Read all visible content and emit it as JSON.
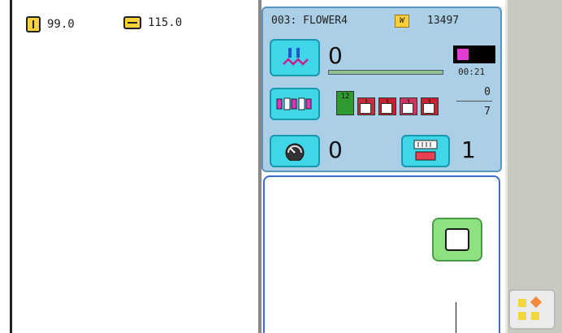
{
  "dimensions": {
    "height_icon": "vertical-size-icon",
    "height_value": "99.0",
    "width_icon": "horizontal-size-icon",
    "width_value": "115.0"
  },
  "pattern": {
    "label": "003: FLOWER4",
    "stitch_count_icon": "stitch-count-icon",
    "stitch_count": "13497"
  },
  "current_stitch": {
    "value": "0",
    "progress_fraction": 0
  },
  "time": "00:21",
  "colors": {
    "spools": [
      "12",
      "1",
      "1",
      "1",
      "1"
    ],
    "needle_current": "0",
    "needle_total": "7"
  },
  "speed": {
    "value": "0"
  },
  "jump": {
    "value": "1"
  },
  "accent_colors": {
    "panel": "#aacfe6",
    "button": "#3fd6ea",
    "frame_button": "#8fe07f",
    "border": "#3a6ad0"
  }
}
